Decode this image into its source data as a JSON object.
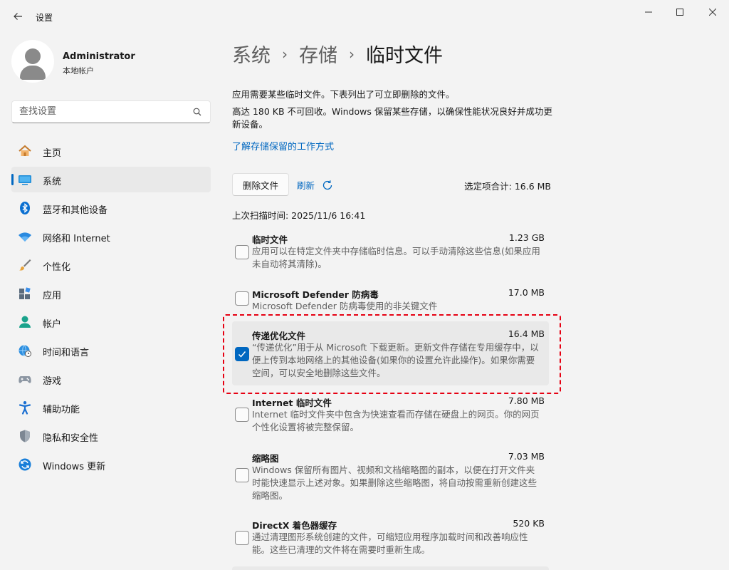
{
  "window": {
    "title": "设置"
  },
  "profile": {
    "name": "Administrator",
    "account_type": "本地帐户"
  },
  "search": {
    "placeholder": "查找设置"
  },
  "nav": {
    "items": [
      {
        "label": "主页"
      },
      {
        "label": "系统"
      },
      {
        "label": "蓝牙和其他设备"
      },
      {
        "label": "网络和 Internet"
      },
      {
        "label": "个性化"
      },
      {
        "label": "应用"
      },
      {
        "label": "帐户"
      },
      {
        "label": "时间和语言"
      },
      {
        "label": "游戏"
      },
      {
        "label": "辅助功能"
      },
      {
        "label": "隐私和安全性"
      },
      {
        "label": "Windows 更新"
      }
    ],
    "active_index": 1
  },
  "breadcrumb": {
    "items": [
      "系统",
      "存储",
      "临时文件"
    ],
    "separator": "›"
  },
  "main": {
    "description": "应用需要某些临时文件。下表列出了可立即删除的文件。",
    "reserved_note": "高达 180 KB 不可回收。Windows 保留某些存储，以确保性能状况良好并成功更新设备。",
    "learn_link": "了解存储保留的工作方式",
    "delete_button": "删除文件",
    "refresh_label": "刷新",
    "selected_total": "选定项合计: 16.6 MB",
    "last_scan": "上次扫描时间: 2025/11/6 16:41"
  },
  "files": [
    {
      "name": "临时文件",
      "size": "1.23 GB",
      "description": "应用可以在特定文件夹中存储临时信息。可以手动清除这些信息(如果应用未自动将其清除)。",
      "checked": false
    },
    {
      "name": "Microsoft Defender 防病毒",
      "size": "17.0 MB",
      "description": "Microsoft Defender 防病毒使用的非关键文件",
      "checked": false
    },
    {
      "name": "传递优化文件",
      "size": "16.4 MB",
      "description": "“传递优化”用于从 Microsoft 下载更新。更新文件存储在专用缓存中，以便上传到本地网络上的其他设备(如果你的设置允许此操作)。如果你需要空间，可以安全地删除这些文件。",
      "checked": true
    },
    {
      "name": "Internet 临时文件",
      "size": "7.80 MB",
      "description": "Internet 临时文件夹中包含为快速查看而存储在硬盘上的网页。你的网页个性化设置将被完整保留。",
      "checked": false
    },
    {
      "name": "缩略图",
      "size": "7.03 MB",
      "description": "Windows 保留所有图片、视频和文档缩略图的副本，以便在打开文件夹时能快速显示上述对象。如果删除这些缩略图，将自动按需重新创建这些缩略图。",
      "checked": false
    },
    {
      "name": "DirectX 着色器缓存",
      "size": "520 KB",
      "description": "通过清理图形系统创建的文件，可缩短应用程序加载时间和改善响应性能。这些已清理的文件将在需要时重新生成。",
      "checked": false
    }
  ],
  "colors": {
    "accent": "#0067c0",
    "highlight_border": "#e60012",
    "background": "#f3f3f3"
  },
  "icons": [
    "back-arrow-icon",
    "minimize-icon",
    "maximize-icon",
    "close-icon",
    "search-icon",
    "refresh-icon",
    "checkmark-icon"
  ]
}
